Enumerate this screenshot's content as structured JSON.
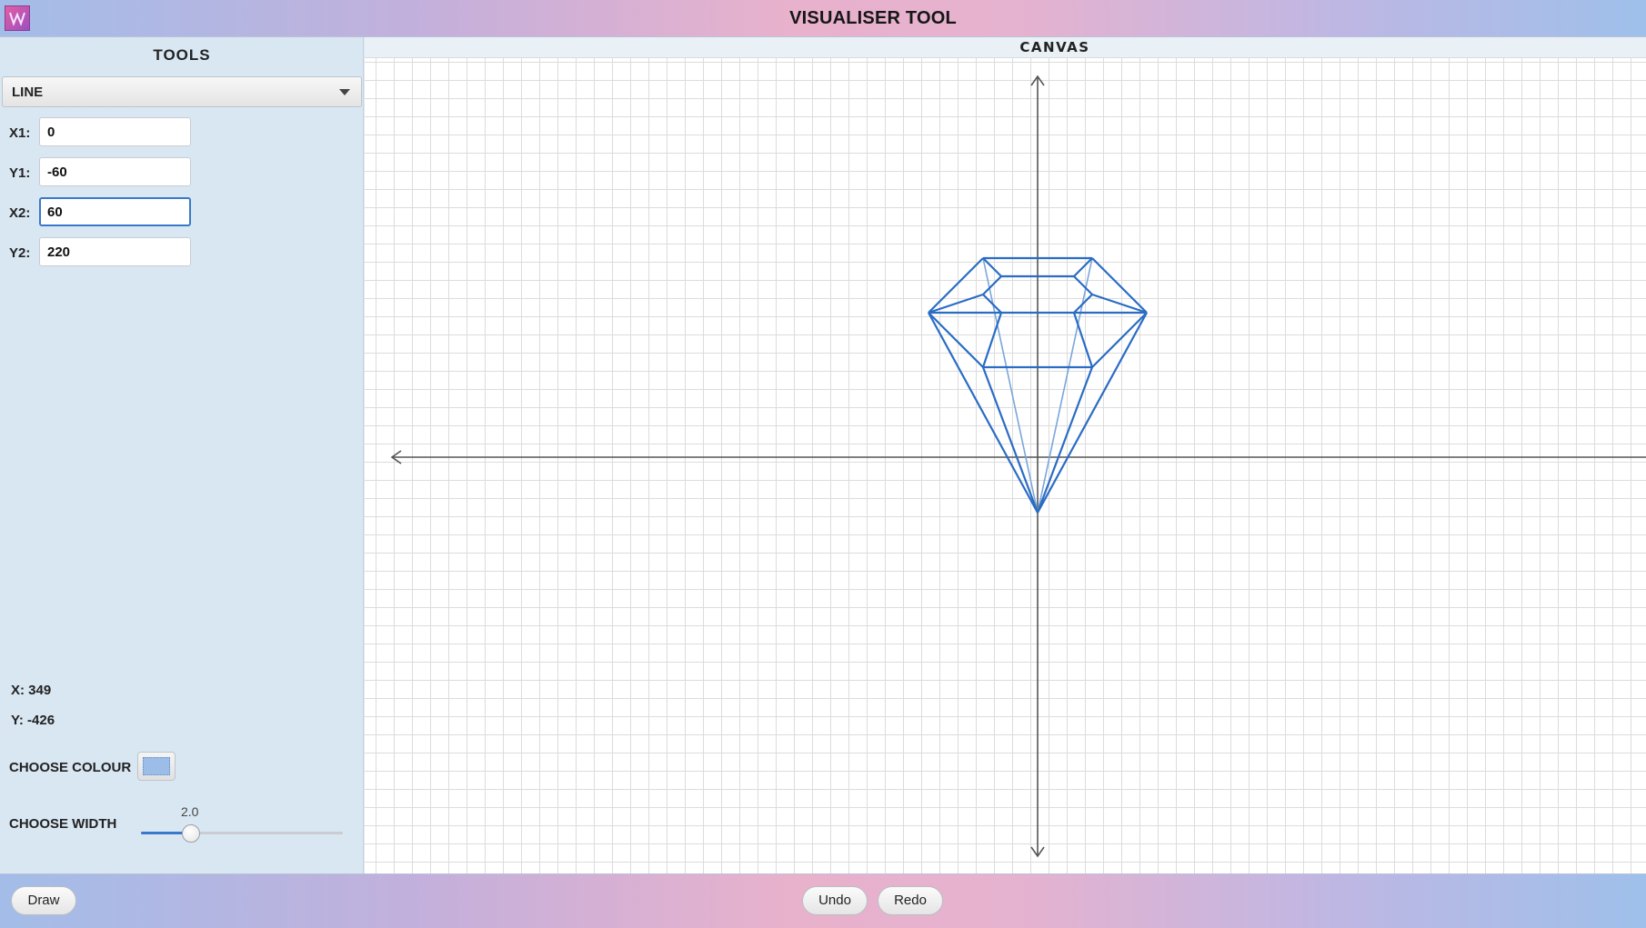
{
  "app": {
    "title": "VISUALISER TOOL",
    "icon": "app-logo-icon"
  },
  "sidebar": {
    "title": "TOOLS",
    "shape_select": {
      "selected": "LINE",
      "icon": "chevron-down-icon"
    },
    "fields": [
      {
        "label": "X1:",
        "value": "0"
      },
      {
        "label": "Y1:",
        "value": "-60"
      },
      {
        "label": "X2:",
        "value": "60"
      },
      {
        "label": "Y2:",
        "value": "220"
      }
    ],
    "mouse": {
      "x": "X: 349",
      "y": "Y: -426"
    },
    "colour": {
      "label": "CHOOSE COLOUR",
      "value": "#9bbde8"
    },
    "width": {
      "label": "CHOOSE WIDTH",
      "value": "2.0"
    }
  },
  "canvas": {
    "title": "CANVAS",
    "line_color": "#2a6cc4",
    "light_line_color": "#7aa6db",
    "axis_color": "#555555"
  },
  "footer": {
    "draw": "Draw",
    "undo": "Undo",
    "redo": "Redo"
  }
}
